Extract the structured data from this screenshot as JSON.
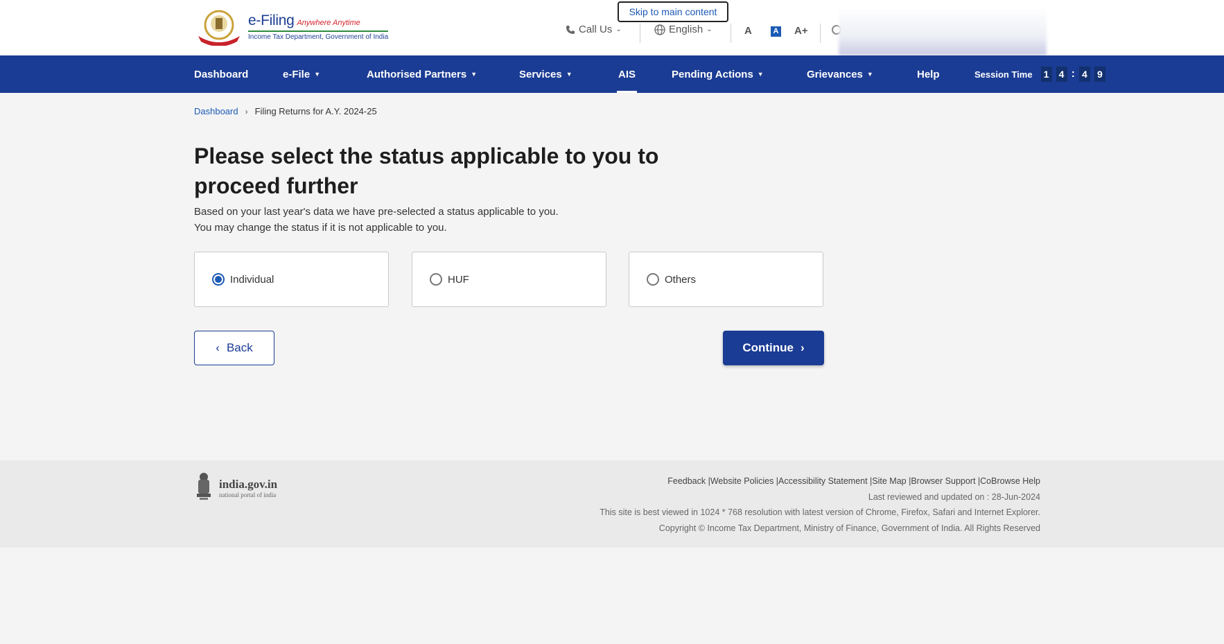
{
  "header": {
    "logo_title": "e-Filing",
    "logo_tagline": "Anywhere Anytime",
    "logo_subtitle": "Income Tax Department, Government of India",
    "skip_link": "Skip to main content",
    "call_us": "Call Us",
    "language": "English",
    "font_decrease": "A",
    "font_default": "A",
    "font_increase": "A+"
  },
  "nav": {
    "items": [
      {
        "label": "Dashboard"
      },
      {
        "label": "e-File"
      },
      {
        "label": "Authorised Partners"
      },
      {
        "label": "Services"
      },
      {
        "label": "AIS"
      },
      {
        "label": "Pending Actions"
      },
      {
        "label": "Grievances"
      },
      {
        "label": "Help"
      }
    ],
    "session_label": "Session Time",
    "session_digits": [
      "1",
      "4",
      "4",
      "9"
    ]
  },
  "breadcrumb": {
    "home": "Dashboard",
    "current": "Filing Returns for A.Y. 2024-25"
  },
  "main": {
    "heading": "Please select the status applicable to you to proceed further",
    "subtext_line1": "Based on your last year's data we have pre-selected a status applicable to you.",
    "subtext_line2": "You may change the status if it is not applicable to you.",
    "options": [
      {
        "label": "Individual",
        "selected": true
      },
      {
        "label": "HUF",
        "selected": false
      },
      {
        "label": "Others",
        "selected": false
      }
    ],
    "back_label": "Back",
    "continue_label": "Continue"
  },
  "footer": {
    "portal_title": "india.gov.in",
    "portal_subtitle": "national portal of india",
    "links": "Feedback |Website Policies |Accessibility Statement |Site Map |Browser Support |CoBrowse Help",
    "last_reviewed": "Last reviewed and updated on : 28-Jun-2024",
    "best_viewed": "This site is best viewed in 1024 * 768 resolution with latest version of Chrome, Firefox, Safari and Internet Explorer.",
    "copyright": "Copyright © Income Tax Department, Ministry of Finance, Government of India. All Rights Reserved"
  },
  "colors": {
    "nav_bg": "#1b3c94",
    "link": "#1c5ab5"
  }
}
